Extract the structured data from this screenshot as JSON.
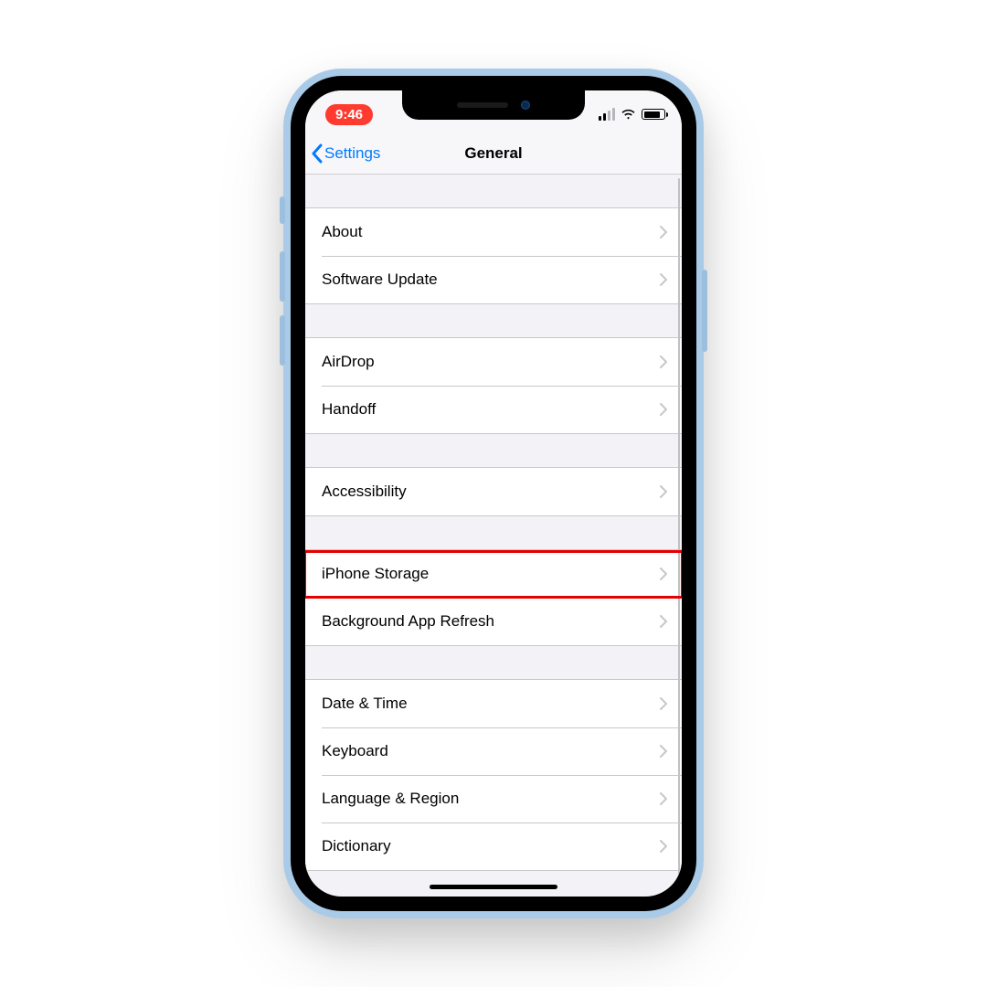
{
  "status_bar": {
    "time": "9:46",
    "recording": true
  },
  "nav": {
    "back_label": "Settings",
    "title": "General"
  },
  "groups": [
    {
      "items": [
        {
          "key": "about",
          "label": "About"
        },
        {
          "key": "software-update",
          "label": "Software Update"
        }
      ]
    },
    {
      "items": [
        {
          "key": "airdrop",
          "label": "AirDrop"
        },
        {
          "key": "handoff",
          "label": "Handoff"
        }
      ]
    },
    {
      "items": [
        {
          "key": "accessibility",
          "label": "Accessibility"
        }
      ]
    },
    {
      "items": [
        {
          "key": "iphone-storage",
          "label": "iPhone Storage",
          "highlighted": true
        },
        {
          "key": "background-app-refresh",
          "label": "Background App Refresh"
        }
      ]
    },
    {
      "items": [
        {
          "key": "date-time",
          "label": "Date & Time"
        },
        {
          "key": "keyboard",
          "label": "Keyboard"
        },
        {
          "key": "language-region",
          "label": "Language & Region"
        },
        {
          "key": "dictionary",
          "label": "Dictionary"
        }
      ]
    }
  ]
}
